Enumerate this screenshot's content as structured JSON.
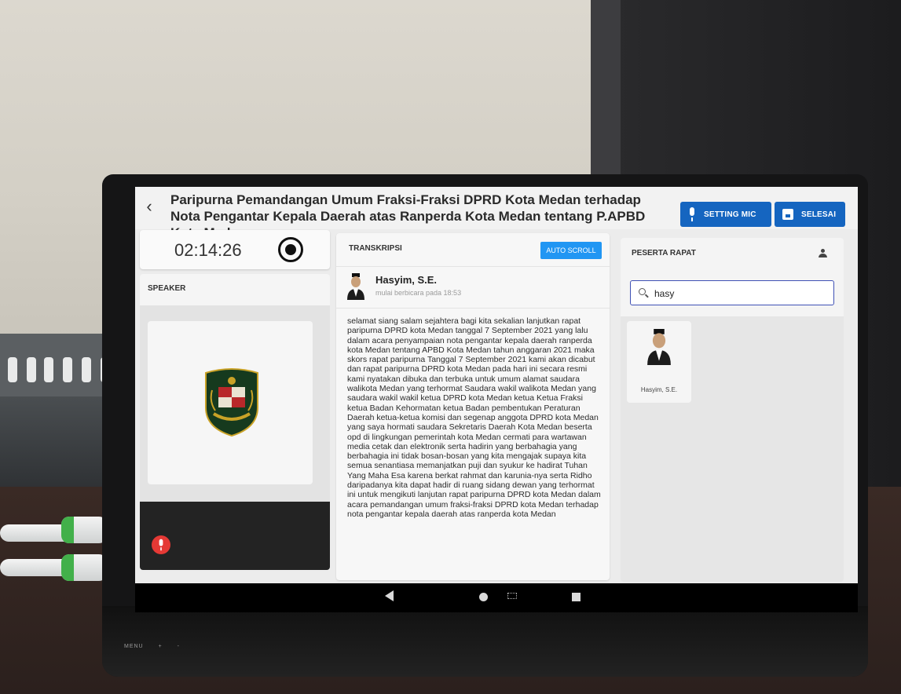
{
  "header": {
    "back_symbol": "‹",
    "title": "Paripurna Pemandangan Umum Fraksi-Fraksi DPRD Kota Medan terhadap Nota Pengantar Kepala Daerah atas Ranperda Kota Medan tentang P.APBD Kota Medan",
    "setting_mic_label": "SETTING MIC",
    "selesai_label": "SELESAI",
    "accent_color": "#1565c0"
  },
  "timer": {
    "elapsed": "02:14:26"
  },
  "speaker_panel": {
    "title": "SPEAKER",
    "icons": [
      "record-icon",
      "emblem-icon",
      "mic-icon"
    ],
    "mic_color": "#e53935"
  },
  "transcript": {
    "title": "TRANSKRIPSI",
    "autoscroll_label": "AUTO SCROLL",
    "speaker_name": "Hasyim, S.E.",
    "speaker_time": "mulai berbicara pada 18:53",
    "text": "selamat siang salam sejahtera bagi kita sekalian lanjutkan rapat paripurna DPRD kota Medan tanggal 7 September 2021 yang lalu dalam acara penyampaian nota pengantar kepala daerah ranperda kota Medan tentang APBD Kota Medan tahun anggaran 2021 maka skors rapat paripurna Tanggal 7 September 2021 kami akan dicabut dan rapat paripurna DPRD kota Medan pada hari ini secara resmi kami nyatakan dibuka dan terbuka untuk umum alamat saudara walikota Medan yang terhormat Saudara wakil walikota Medan yang saudara wakil wakil ketua DPRD kota Medan ketua Ketua Fraksi ketua Badan Kehormatan ketua Badan pembentukan Peraturan Daerah ketua-ketua komisi dan segenap anggota DPRD kota Medan yang saya hormati saudara Sekretaris Daerah Kota Medan beserta opd di lingkungan pemerintah kota Medan cermati para wartawan media cetak dan elektronik serta hadirin yang berbahagia yang berbahagia ini tidak bosan-bosan yang kita mengajak supaya kita semua senantiasa memanjatkan puji dan syukur ke hadirat Tuhan Yang Maha Esa karena berkat rahmat dan karunia-nya serta Ridho daripadanya kita dapat hadir di ruang sidang dewan yang terhormat ini untuk mengikuti lanjutan rapat paripurna DPRD kota Medan dalam acara pemandangan umum fraksi-fraksi DPRD kota Medan terhadap nota pengantar kepala daerah atas ranperda kota Medan",
    "button_color": "#2196f3"
  },
  "peserta": {
    "title": "PESERTA RAPAT",
    "search_value": "hasy",
    "search_placeholder": "",
    "participants": [
      {
        "name": "Hasyim, S.E."
      }
    ]
  },
  "device": {
    "monitor_labels": [
      "MENU",
      "+",
      "-"
    ]
  }
}
